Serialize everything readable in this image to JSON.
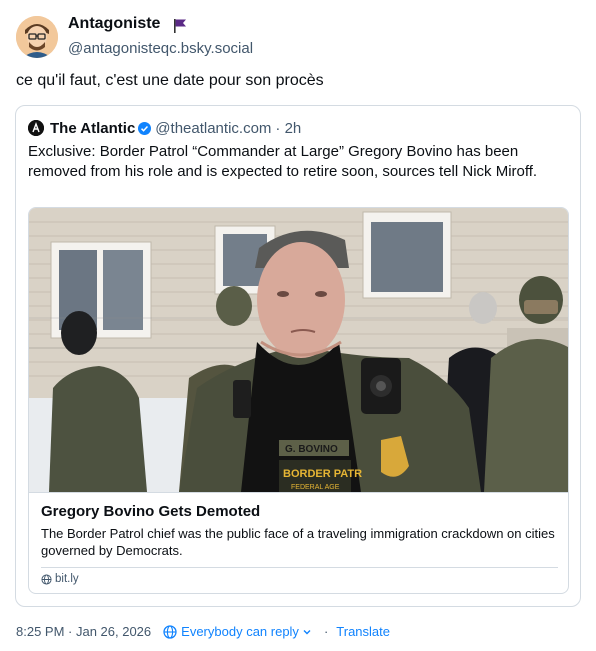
{
  "post": {
    "author": {
      "name": "Antagoniste",
      "handle": "@antagonisteqc.bsky.social",
      "avatar": "avatar-icon",
      "flag_color": "#5b2a86"
    },
    "text": "ce qu'il faut, c'est une date pour son procès",
    "quote": {
      "author_name": "The Atlantic",
      "handle": "@theatlantic.com",
      "time": "· 2h",
      "text": "Exclusive: Border Patrol “Commander at Large” Gregory Bovino has been removed from his role and is expected to retire soon, sources tell Nick Miroff.",
      "card": {
        "title": "Gregory Bovino Gets Demoted",
        "description": "The Border Patrol chief was the public face of a traveling immigration crackdown on cities governed by Democrats.",
        "domain": "bit.ly",
        "image_text": {
          "nameplate": "G. BOVINO",
          "patch": "BORDER PATR",
          "patch_sub": "FEDERAL AGE"
        }
      }
    },
    "meta": {
      "timestamp": "8:25 PM · Jan 26, 2026",
      "reply_setting": "Everybody can reply",
      "separator": "·",
      "translate": "Translate"
    }
  },
  "colors": {
    "link": "#1083fe",
    "muted": "#42576c",
    "border": "#d4dbe2",
    "verified": "#1083fe"
  }
}
